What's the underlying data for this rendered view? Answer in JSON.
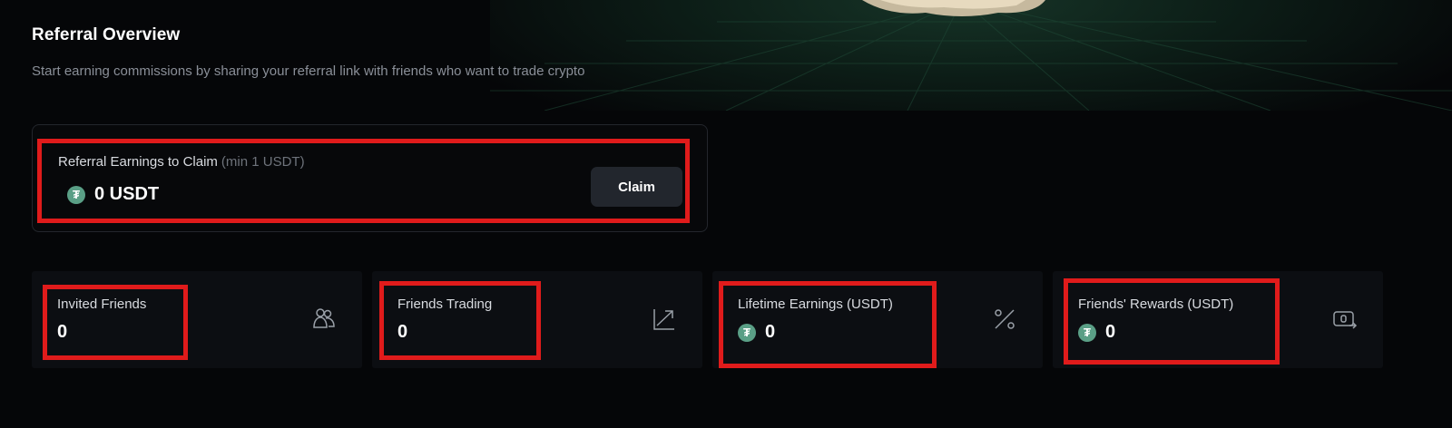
{
  "header": {
    "title": "Referral Overview",
    "subtitle": "Start earning commissions by sharing your referral link with friends who want to trade crypto"
  },
  "claim": {
    "label": "Referral Earnings to Claim",
    "min_note": "(min 1 USDT)",
    "amount": "0 USDT",
    "button": "Claim",
    "token_icon": "tether-icon"
  },
  "stats": [
    {
      "label": "Invited Friends",
      "value": "0",
      "icon": "friends-icon",
      "has_token": false
    },
    {
      "label": "Friends Trading",
      "value": "0",
      "icon": "trend-arrow-icon",
      "has_token": false
    },
    {
      "label": "Lifetime Earnings (USDT)",
      "value": "0",
      "icon": "percent-icon",
      "has_token": true
    },
    {
      "label": "Friends' Rewards (USDT)",
      "value": "0",
      "icon": "wallet-transfer-icon",
      "has_token": true
    }
  ],
  "colors": {
    "background": "#050608",
    "card": "#0c0e12",
    "tether": "#5a9f86",
    "highlight": "#e01b1b",
    "muted_text": "#8a8f98"
  }
}
